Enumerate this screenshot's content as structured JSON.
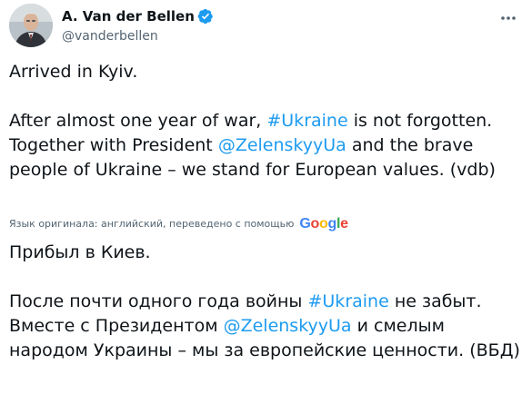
{
  "author": {
    "display_name": "A. Van der Bellen",
    "handle": "@vanderbellen",
    "verified_icon": "verified-badge-icon",
    "avatar_icon": "profile-photo"
  },
  "more_icon": "more-options-icon",
  "tweet": {
    "line1": "Arrived in Kyiv.",
    "p2_a": "After almost one year of war, ",
    "p2_hashtag": "#Ukraine",
    "p2_b": " is not forgotten. Together with President ",
    "p2_mention": "@ZelenskyyUa",
    "p2_c": " and the brave people of Ukraine – we stand for European values. (vdb)"
  },
  "translation": {
    "note": "Язык оригинала: английский, переведено с помощью",
    "provider": "Google",
    "line1": "Прибыл в Киев.",
    "p2_a": "После почти одного года войны ",
    "p2_hashtag": "#Ukraine",
    "p2_b": " не забыт. Вместе с Президентом ",
    "p2_mention": "@ZelenskyyUa",
    "p2_c": " и смелым народом Украины – мы за европейские ценности. (ВБД)"
  },
  "colors": {
    "link": "#1d9bf0",
    "text": "#0f1419",
    "muted": "#536471",
    "google_blue": "#4285f4",
    "google_red": "#ea4335",
    "google_yellow": "#fbbc05",
    "google_green": "#34a853"
  }
}
